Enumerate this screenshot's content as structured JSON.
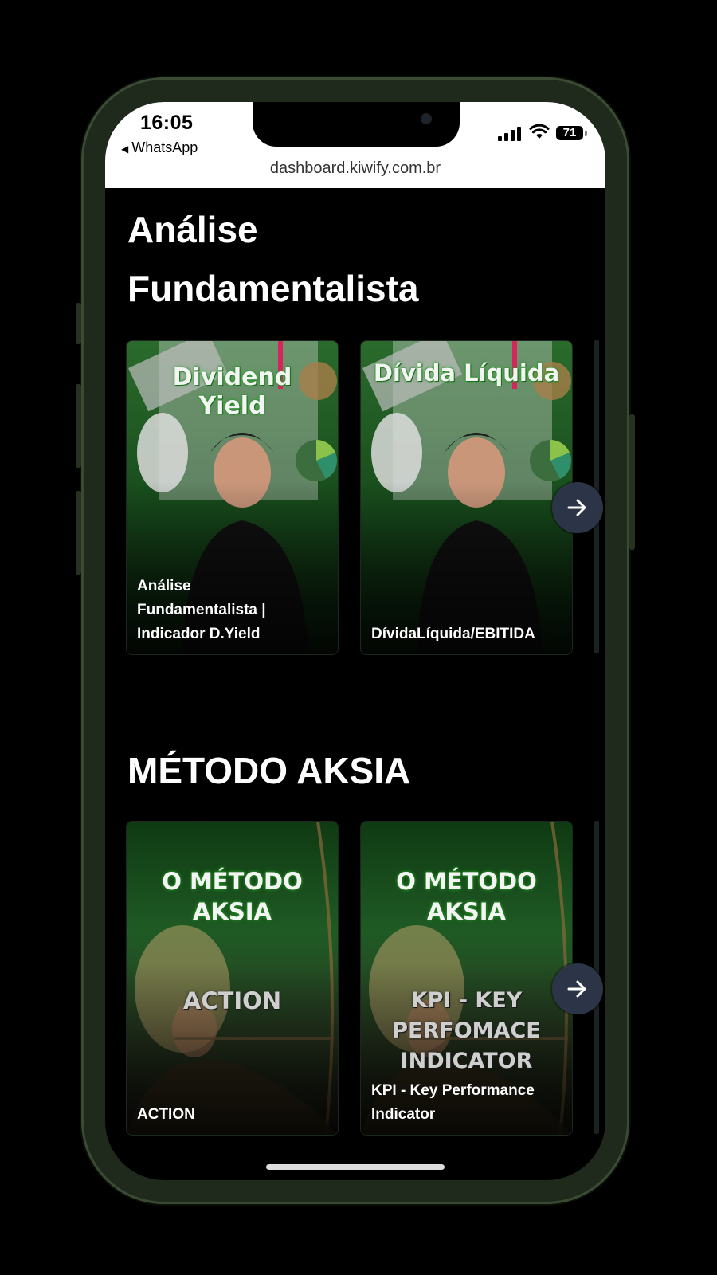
{
  "status_bar": {
    "time": "16:05",
    "back_app": "WhatsApp",
    "battery": "71"
  },
  "browser": {
    "url": "dashboard.kiwify.com.br"
  },
  "sections": [
    {
      "title_line1": "Análise",
      "title_line2": "Fundamentalista",
      "cards": [
        {
          "art_title_line1": "Dividend",
          "art_title_line2": "Yield",
          "label_line1": "Análise",
          "label_line2": "Fundamentalista |",
          "label_line3": "Indicador D.Yield"
        },
        {
          "art_title_line1": "Dívida Líquida",
          "label_line1": "DívidaLíquida/EBITIDA"
        }
      ]
    },
    {
      "title_line1": "MÉTODO AKSIA",
      "cards": [
        {
          "art_title_line1": "O MÉTODO",
          "art_title_line2": "AKSIA",
          "art_subtitle_line1": "ACTION",
          "label_line1": "ACTION"
        },
        {
          "art_title_line1": "O MÉTODO",
          "art_title_line2": "AKSIA",
          "art_subtitle_line1": "KPI - KEY",
          "art_subtitle_line2": "PERFOMACE",
          "art_subtitle_line3": "INDICATOR",
          "label_line1": "KPI - Key Performance",
          "label_line2": "Indicator"
        }
      ]
    }
  ],
  "icons": {
    "next": "arrow-right-icon",
    "back": "back-triangle-icon",
    "signal": "cellular-signal-icon",
    "wifi": "wifi-icon",
    "battery": "battery-icon"
  },
  "colors": {
    "background": "#000000",
    "card_green": "#1f5a24",
    "arrow_button": "#2b3547",
    "glow_green": "#2aa52a"
  }
}
